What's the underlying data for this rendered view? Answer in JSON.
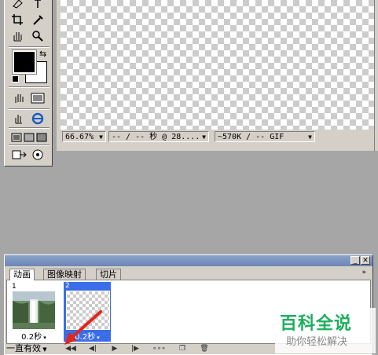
{
  "toolbox": {
    "foreground_color": "#000000",
    "background_color": "#ffffff"
  },
  "statusbar": {
    "zoom": "66.67%",
    "timing": "-- / -- 秒 @ 28....",
    "size": "~570K / -- GIF"
  },
  "animation_panel": {
    "tabs": [
      "动画",
      "图像映射",
      "切片"
    ],
    "frames": [
      {
        "number": "1",
        "delay": "0.2秒"
      },
      {
        "number": "2",
        "delay": "0.2秒"
      }
    ],
    "loop_option": "一直有效"
  },
  "watermark": {
    "title": "百科全说",
    "subtitle": "助你轻松解决"
  },
  "colors": {
    "selection_blue": "#3a6ee8",
    "arrow_red": "#e0261d",
    "watermark_green": "#1bb05b"
  }
}
